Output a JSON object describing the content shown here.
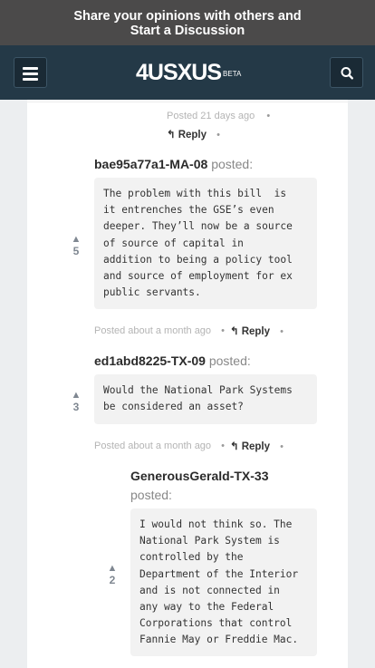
{
  "promo": {
    "line1": "Share your opinions with others and",
    "line2": "Start a Discussion"
  },
  "navbar": {
    "logo": "4USXUS",
    "logo_badge": "BETA",
    "menu_icon": "hamburger-menu-icon",
    "search_icon": "search-icon"
  },
  "thread": {
    "top_meta": {
      "time": "Posted 21 days ago",
      "dot": "•",
      "reply_label": "Reply"
    },
    "comments": [
      {
        "author": "bae95a77a1-MA-08",
        "posted_label": "posted:",
        "votes": "5",
        "body": "The problem with this bill  is\nit entrenches the GSE’s even\ndeeper. They’ll now be a source\nof source of capital in\naddition to being a policy tool\nand source of employment for ex\npublic servants.",
        "time": "Posted about a month ago",
        "reply_label": "Reply",
        "dot": "•"
      },
      {
        "author": "ed1abd8225-TX-09",
        "posted_label": "posted:",
        "votes": "3",
        "body": "Would the National Park Systems\nbe considered an asset?",
        "time": "Posted about a month ago",
        "reply_label": "Reply",
        "dot": "•"
      },
      {
        "author": "GenerousGerald-TX-33",
        "posted_label": "posted:",
        "votes": "2",
        "body": "I would not think so. The\nNational Park System is\ncontrolled by the\nDepartment of the Interior\nand is not connected in\nany way to the Federal\nCorporations that control\nFannie May or Freddie Mac."
      }
    ]
  },
  "colors": {
    "promo_bg": "#4b4a4a",
    "navbar_bg": "#243947",
    "page_bg": "#eceef0",
    "bubble_bg": "#f2f2f2",
    "vote_color": "#7f8791"
  }
}
